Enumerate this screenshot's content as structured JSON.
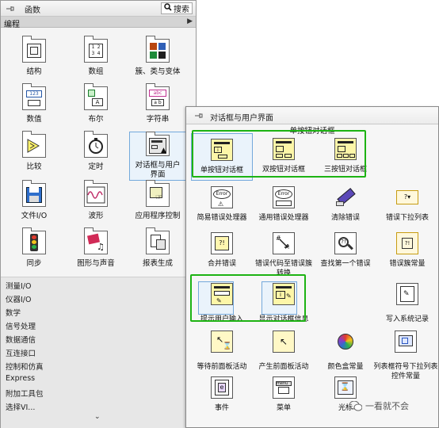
{
  "functions_palette": {
    "title": "函数",
    "search_label": "搜索",
    "category": "编程",
    "items": [
      {
        "label": "结构"
      },
      {
        "label": "数组"
      },
      {
        "label": "簇、类与变体"
      },
      {
        "label": "数值"
      },
      {
        "label": "布尔"
      },
      {
        "label": "字符串"
      },
      {
        "label": "比较"
      },
      {
        "label": "定时"
      },
      {
        "label": "对话框与用户界面"
      },
      {
        "label": "文件I/O"
      },
      {
        "label": "波形"
      },
      {
        "label": "应用程序控制"
      },
      {
        "label": "同步"
      },
      {
        "label": "图形与声音"
      },
      {
        "label": "报表生成"
      }
    ],
    "categories": [
      "测量I/O",
      "仪器I/O",
      "数学",
      "信号处理",
      "数据通信",
      "互连接口",
      "控制和仿真",
      "Express",
      "附加工具包",
      "选择VI..."
    ],
    "more": "⌄"
  },
  "dialog_palette": {
    "title": "对话框与用户界面",
    "section_label": "单按钮对话框",
    "items": [
      {
        "label": "单按钮对话框"
      },
      {
        "label": "双按钮对话框"
      },
      {
        "label": "三按钮对话框"
      },
      {
        "label": "简易错误处理器"
      },
      {
        "label": "通用错误处理器"
      },
      {
        "label": "清除错误"
      },
      {
        "label": "错误下拉列表"
      },
      {
        "label": "合并错误"
      },
      {
        "label": "错误代码至错误簇转换"
      },
      {
        "label": "查找第一个错误"
      },
      {
        "label": "错误簇常量"
      },
      {
        "label": "提示用户输入"
      },
      {
        "label": "显示对话框信息"
      },
      {
        "label": "写入系统记录"
      },
      {
        "label": "等待前面板活动"
      },
      {
        "label": "产生前面板活动"
      },
      {
        "label": "颜色盒常量"
      },
      {
        "label": "列表框符号下拉列表控件常量"
      },
      {
        "label": "事件"
      },
      {
        "label": "菜单"
      },
      {
        "label": "光标"
      }
    ]
  },
  "watermark": {
    "text": "一看就不会"
  },
  "colors": {
    "highlight_green": "#1db313",
    "selection_blue": "#74a9dc"
  }
}
